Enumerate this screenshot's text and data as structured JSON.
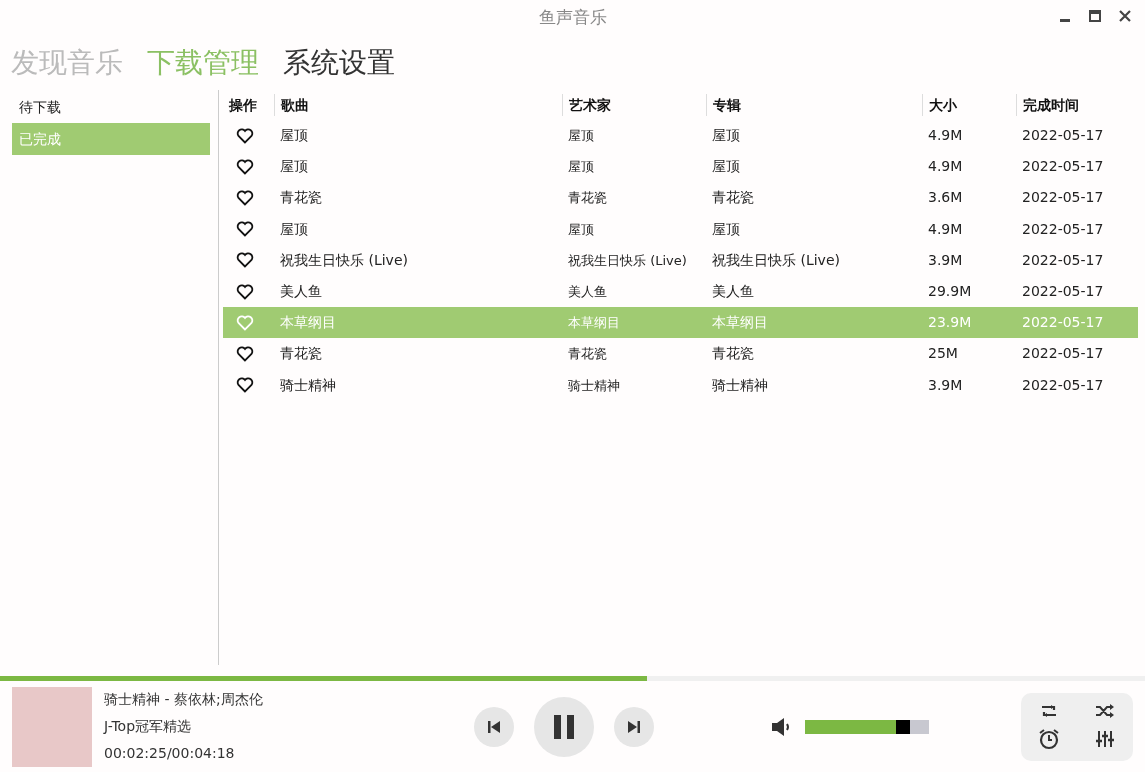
{
  "window": {
    "title": "鱼声音乐"
  },
  "tabs": [
    {
      "label": "发现音乐",
      "selected": false,
      "hovered": false
    },
    {
      "label": "下载管理",
      "selected": true,
      "hovered": false
    },
    {
      "label": "系统设置",
      "selected": false,
      "hovered": true
    }
  ],
  "sidebar": {
    "items": [
      {
        "label": "待下载",
        "selected": false
      },
      {
        "label": "已完成",
        "selected": true
      }
    ]
  },
  "table": {
    "columns": [
      "操作",
      "歌曲",
      "艺术家",
      "专辑",
      "大小",
      "完成时间"
    ],
    "rows": [
      {
        "song": "屋顶",
        "artist": "屋顶",
        "album": "屋顶",
        "size": "4.9M",
        "time": "2022-05-17",
        "selected": false
      },
      {
        "song": "屋顶",
        "artist": "屋顶",
        "album": "屋顶",
        "size": "4.9M",
        "time": "2022-05-17",
        "selected": false
      },
      {
        "song": "青花瓷",
        "artist": "青花瓷",
        "album": "青花瓷",
        "size": "3.6M",
        "time": "2022-05-17",
        "selected": false
      },
      {
        "song": "屋顶",
        "artist": "屋顶",
        "album": "屋顶",
        "size": "4.9M",
        "time": "2022-05-17",
        "selected": false
      },
      {
        "song": "祝我生日快乐 (Live)",
        "artist": "祝我生日快乐 (Live)",
        "album": "祝我生日快乐 (Live)",
        "size": "3.9M",
        "time": "2022-05-17",
        "selected": false
      },
      {
        "song": "美人鱼",
        "artist": "美人鱼",
        "album": "美人鱼",
        "size": "29.9M",
        "time": "2022-05-17",
        "selected": false
      },
      {
        "song": "本草纲目",
        "artist": "本草纲目",
        "album": "本草纲目",
        "size": "23.9M",
        "time": "2022-05-17",
        "selected": true
      },
      {
        "song": "青花瓷",
        "artist": "青花瓷",
        "album": "青花瓷",
        "size": "25M",
        "time": "2022-05-17",
        "selected": false
      },
      {
        "song": "骑士精神",
        "artist": "骑士精神",
        "album": "骑士精神",
        "size": "3.9M",
        "time": "2022-05-17",
        "selected": false
      }
    ]
  },
  "player": {
    "progress": {
      "level": 0.565
    },
    "title": "骑士精神 - 蔡依林;周杰伦",
    "album": "J-Top冠军精选",
    "time": "00:02:25/00:04:18",
    "volume": {
      "level": 0.85
    }
  }
}
